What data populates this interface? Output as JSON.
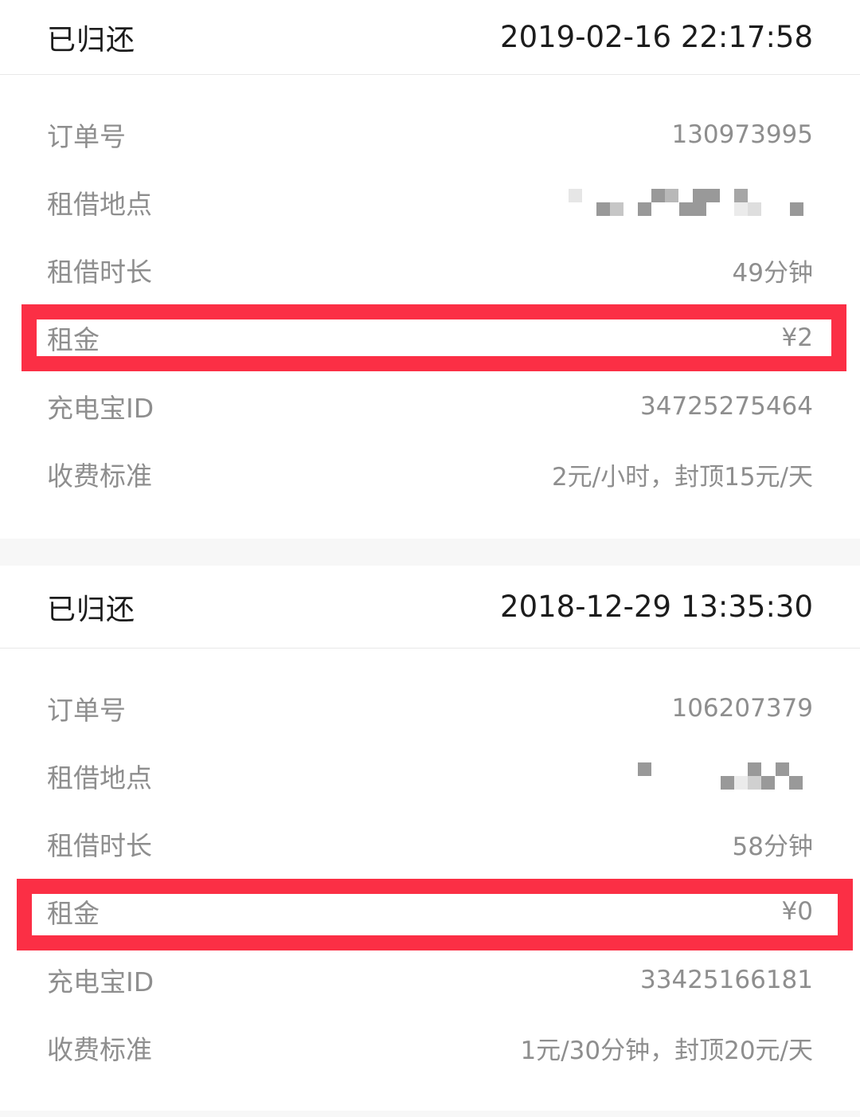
{
  "orders": [
    {
      "status": "已归还",
      "returned_at": "2019-02-16 22:17:58",
      "fields": {
        "order_no": {
          "label": "订单号",
          "value": "130973995"
        },
        "location": {
          "label": "租借地点",
          "value": "(pixelated)"
        },
        "duration": {
          "label": "租借时长",
          "value": "49分钟"
        },
        "rent": {
          "label": "租金",
          "value": "¥2"
        },
        "powerbank_id": {
          "label": "充电宝ID",
          "value": "34725275464"
        },
        "pricing": {
          "label": "收费标准",
          "value": "2元/小时，封顶15元/天"
        }
      }
    },
    {
      "status": "已归还",
      "returned_at": "2018-12-29 13:35:30",
      "fields": {
        "order_no": {
          "label": "订单号",
          "value": "106207379"
        },
        "location": {
          "label": "租借地点",
          "value": "(pixelated)"
        },
        "duration": {
          "label": "租借时长",
          "value": "58分钟"
        },
        "rent": {
          "label": "租金",
          "value": "¥0"
        },
        "powerbank_id": {
          "label": "充电宝ID",
          "value": "33425166181"
        },
        "pricing": {
          "label": "收费标准",
          "value": "1元/30分钟，封顶20元/天"
        }
      }
    }
  ],
  "highlight_color": "#fb2f45"
}
